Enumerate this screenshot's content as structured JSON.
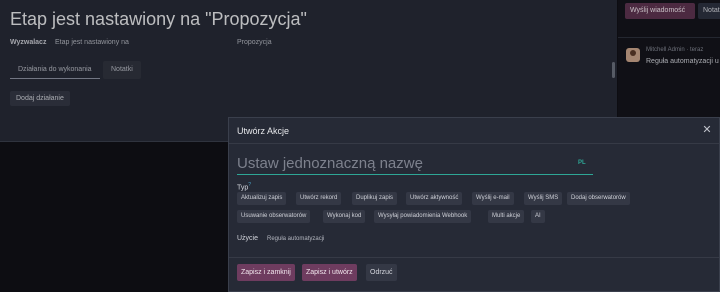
{
  "background": {
    "title": "Etap jest nastawiony na \"Propozycja\"",
    "trigger_label": "Wyzwalacz",
    "trigger_value": "Etap jest nastawiony na",
    "trigger_stage": "Propozycja",
    "tabs": [
      {
        "label": "Działania do wykonania"
      },
      {
        "label": "Notatki"
      }
    ],
    "add_action_label": "Dodaj działanie"
  },
  "chatter": {
    "send_message_label": "Wyślij wiadomość",
    "log_note_label": "Notatka",
    "author": "Mitchell Admin · teraz",
    "message": "Reguła automatyzacji u"
  },
  "modal": {
    "title": "Utwórz Akcje",
    "name_placeholder": "Ustaw jednoznaczną nazwę",
    "lang_label": "PL",
    "type_label": "Typ",
    "type_help": "?",
    "types_row1": [
      "Aktualizuj zapis",
      "Utwórz rekord",
      "Duplikuj zapis",
      "Utwórz aktywność",
      "Wyślij e-mail",
      "Wyślij SMS",
      "Dodaj obserwatorów"
    ],
    "types_row2": [
      "Usuwanie obserwatorów",
      "Wykonaj kod",
      "Wysyłaj powiadomienia Webhook",
      "Multi akcje",
      "AI"
    ],
    "usage_label": "Użycie",
    "usage_value": "Reguła automatyzacji",
    "buttons": {
      "save_close": "Zapisz i zamknij",
      "save_new": "Zapisz i utwórz",
      "discard": "Odrzuć"
    }
  },
  "colors": {
    "primary": "#6e3c5f",
    "accent": "#2ea696",
    "panel": "#262a36",
    "background": "#101016"
  }
}
